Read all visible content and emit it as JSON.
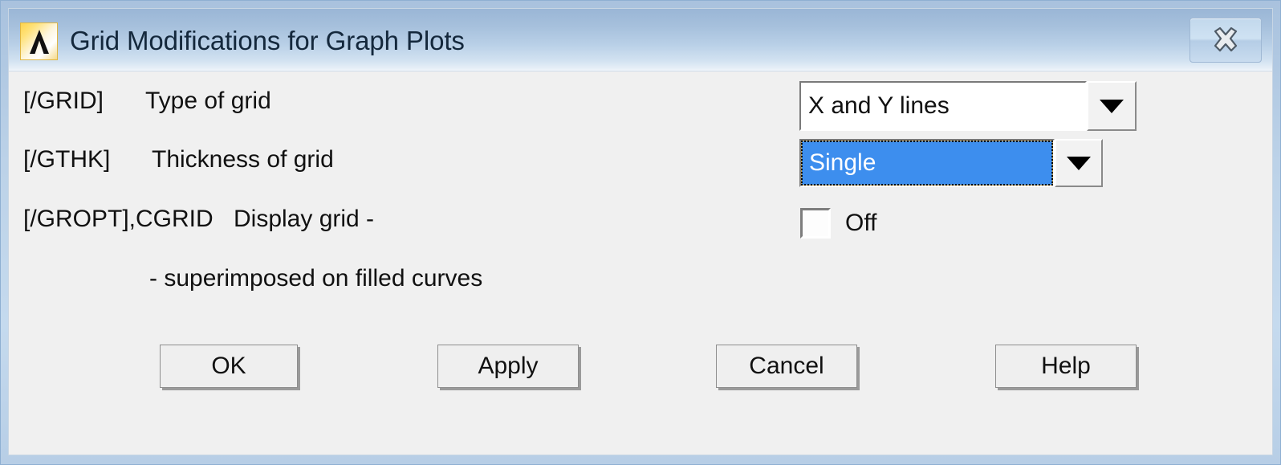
{
  "window": {
    "title": "Grid Modifications for Graph Plots",
    "app_icon": "ansys-logo-icon",
    "close_label": "close-icon"
  },
  "form": {
    "rows": [
      {
        "prompt": "[/GRID]",
        "description": "Type of grid",
        "control": "combo",
        "value": "X and Y lines"
      },
      {
        "prompt": "[/GTHK]",
        "description": "Thickness of grid",
        "control": "combo",
        "value": "Single",
        "focused": true
      },
      {
        "prompt": "[/GROPT],CGRID",
        "description": "Display grid -",
        "control": "checkbox",
        "checkbox_label": "Off",
        "checked": false
      }
    ],
    "note": "- superimposed on filled curves"
  },
  "buttons": {
    "ok": "OK",
    "apply": "Apply",
    "cancel": "Cancel",
    "help": "Help"
  },
  "colors": {
    "selection_blue": "#3d8eee",
    "client_bg": "#f0f0f0",
    "frame_blue": "#b9d0e7"
  }
}
